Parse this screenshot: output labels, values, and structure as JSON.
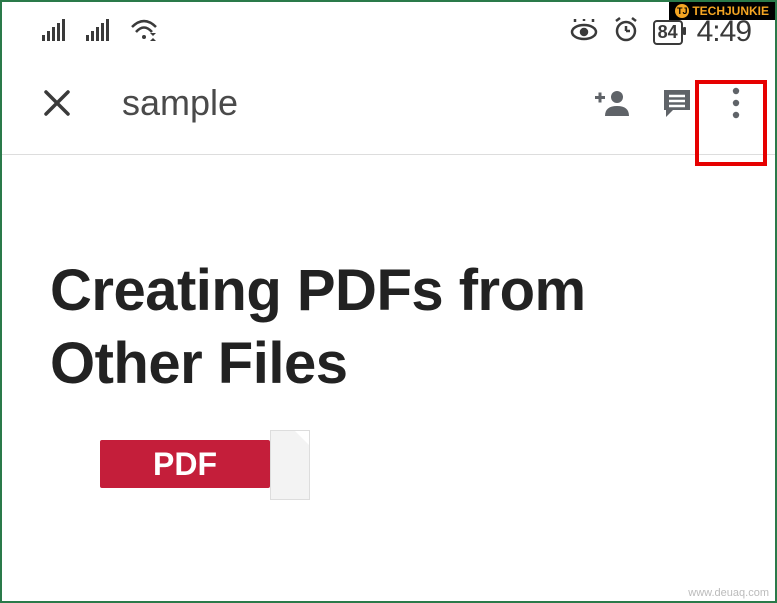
{
  "watermark": {
    "logo": "TJ",
    "text": "TECHJUNKIE"
  },
  "statusbar": {
    "battery_percent": "84",
    "time": "4:49"
  },
  "appbar": {
    "title": "sample"
  },
  "document": {
    "heading": "Creating PDFs from Other Files",
    "pdf_label": "PDF"
  },
  "source_url": "www.deuaq.com"
}
